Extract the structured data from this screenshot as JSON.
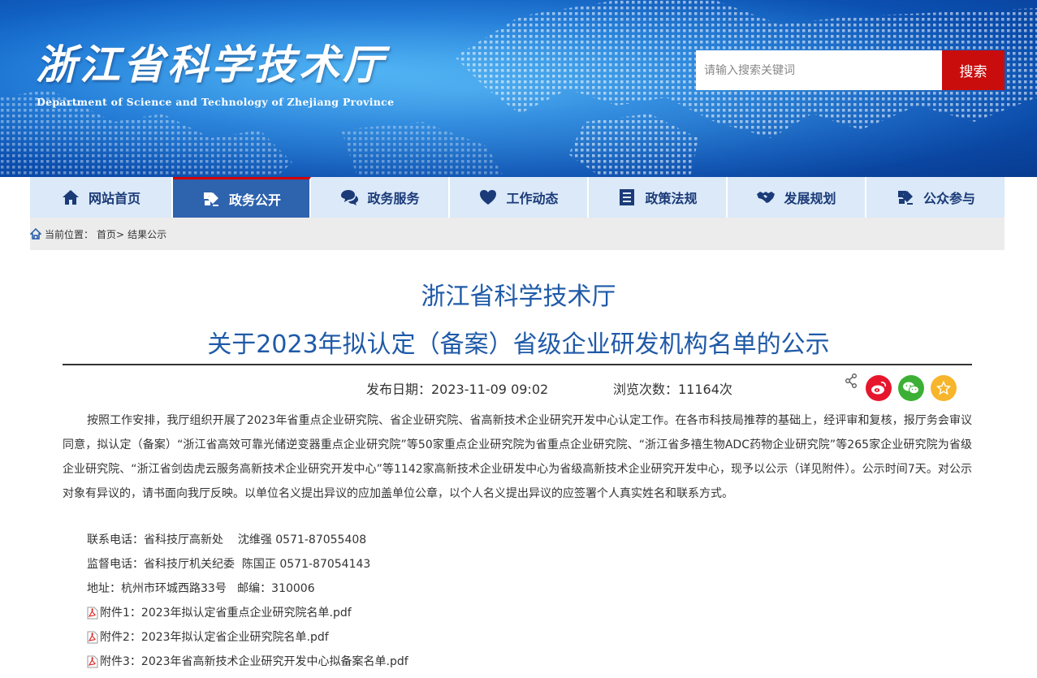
{
  "header": {
    "logo_cn": "浙江省科学技术厅",
    "logo_en": "Department of Science and Technology of Zhejiang Province",
    "search_placeholder": "请输入搜索关键词",
    "search_button": "搜索"
  },
  "nav": {
    "items": [
      {
        "label": "网站首页",
        "icon": "home-icon"
      },
      {
        "label": "政务公开",
        "icon": "gov-open-icon",
        "active": true
      },
      {
        "label": "政务服务",
        "icon": "chat-bubbles-icon"
      },
      {
        "label": "工作动态",
        "icon": "heart-icon"
      },
      {
        "label": "政策法规",
        "icon": "document-list-icon"
      },
      {
        "label": "发展规划",
        "icon": "handshake-icon"
      },
      {
        "label": "公众参与",
        "icon": "participation-icon"
      }
    ]
  },
  "breadcrumb": {
    "prefix": "当前位置：",
    "home": "首页>",
    "current": "结果公示"
  },
  "article": {
    "org": "浙江省科学技术厅",
    "title": "关于2023年拟认定（备案）省级企业研发机构名单的公示",
    "publish_date": "发布日期：2023-11-09 09:02",
    "views": "浏览次数：11164次",
    "body": "按照工作安排，我厅组织开展了2023年省重点企业研究院、省企业研究院、省高新技术企业研究开发中心认定工作。在各市科技局推荐的基础上，经评审和复核，报厅务会审议同意，拟认定（备案）“浙江省高效可靠光储逆变器重点企业研究院”等50家重点企业研究院为省重点企业研究院、“浙江省多禧生物ADC药物企业研究院”等265家企业研究院为省级企业研究院、“浙江省剑齿虎云服务高新技术企业研究开发中心”等1142家高新技术企业研发中心为省级高新技术企业研究开发中心，现予以公示（详见附件）。公示时间7天。对公示对象有异议的，请书面向我厅反映。以单位名义提出异议的应加盖单位公章，以个人名义提出异议的应签署个人真实姓名和联系方式。",
    "contact_phone": "联系电话：省科技厅高新处    沈维强 0571-87055408",
    "supervise_phone": "监督电话：省科技厅机关纪委  陈国正 0571-87054143",
    "address": "地址：杭州市环城西路33号   邮编：310006",
    "attachments": [
      "附件1：2023年拟认定省重点企业研究院名单.pdf",
      "附件2：2023年拟认定省企业研究院名单.pdf",
      "附件3：2023年省高新技术企业研究开发中心拟备案名单.pdf"
    ]
  },
  "share": {
    "weibo_color": "#e6162d",
    "wechat_color": "#3cb034",
    "favorite_color": "#f7b52c"
  }
}
